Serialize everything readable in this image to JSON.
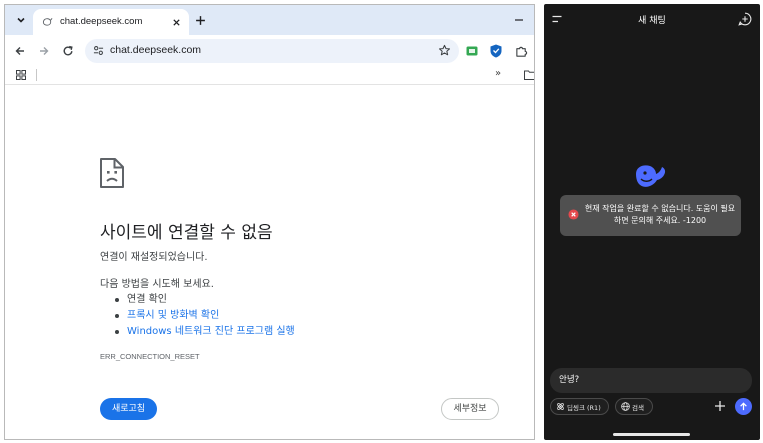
{
  "browser": {
    "tab": {
      "title": "chat.deepseek.com"
    },
    "address_bar": {
      "url": "chat.deepseek.com"
    },
    "bookmarks": {
      "overflow_label": "»"
    },
    "icons": {
      "tab_list": "chevron-down-icon",
      "close_tab": "close-icon",
      "new_tab": "plus-icon",
      "minimize": "minimize-icon",
      "back": "arrow-left-icon",
      "forward": "arrow-right-icon",
      "reload": "reload-icon",
      "site_info": "tune-icon",
      "bookmark": "star-icon",
      "extensions": [
        "green-extension-icon",
        "shield-extension-icon",
        "puzzle-icon"
      ],
      "apps": "apps-grid-icon",
      "bookmarks_folder": "folder-icon",
      "error": "sad-document-icon"
    },
    "error_page": {
      "title": "사이트에 연결할 수 없음",
      "subtitle": "연결이 재설정되었습니다.",
      "suggestion_heading": "다음 방법을 시도해 보세요.",
      "suggestions": [
        {
          "text": "연결 확인",
          "link": false
        },
        {
          "text": "프록시 및 방화벽 확인",
          "link": true
        },
        {
          "text": "Windows 네트워크 진단 프로그램 실행",
          "link": true
        }
      ],
      "error_code": "ERR_CONNECTION_RESET",
      "reload_button": "새로고침",
      "details_button": "세부정보"
    },
    "colors": {
      "tab_strip": "#dfe9f7",
      "omnibox": "#edf2fa",
      "primary_button": "#1a73e8",
      "link": "#1a73e8"
    }
  },
  "mobile": {
    "header": {
      "title": "새 채팅"
    },
    "error_toast": {
      "message": "현재 작업을 완료할 수 없습니다. 도움이 필요하면 문의해 주세요. -1200"
    },
    "input": {
      "value": "안녕?"
    },
    "chips": [
      {
        "label": "딥씽크 (R1)",
        "icon": "atom-icon"
      },
      {
        "label": "검색",
        "icon": "globe-icon"
      }
    ],
    "icons": {
      "menu": "menu-icon",
      "new_chat": "new-chat-icon",
      "logo": "deepseek-whale-logo",
      "toast": "error-circle-icon",
      "attach": "plus-icon",
      "send": "arrow-up-icon"
    },
    "colors": {
      "background": "#181818",
      "toast": "#505050",
      "error_icon": "#e5484d",
      "accent": "#4d6bfe"
    }
  }
}
